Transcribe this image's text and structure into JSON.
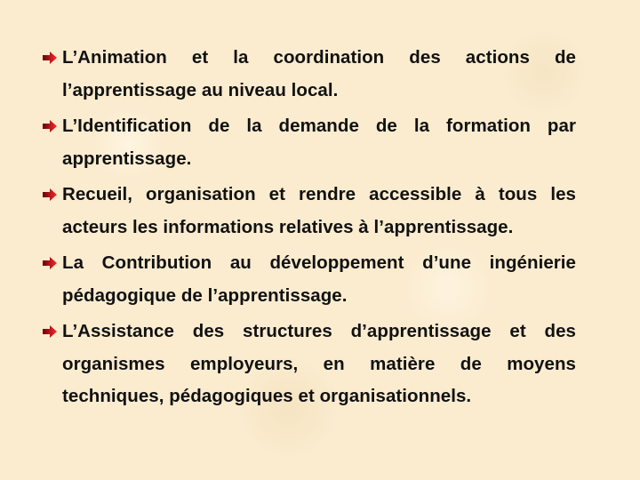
{
  "slide": {
    "bullet_icon": "red-arrow-right-icon",
    "bullet_color": "#d0101a",
    "items": [
      {
        "text": "L’Animation et la coordination des actions de l’apprentissage au niveau local."
      },
      {
        "text": "L’Identification de la demande de la formation par apprentissage."
      },
      {
        "text": "Recueil, organisation et rendre accessible à tous les acteurs les informations relatives à l’apprentissage."
      },
      {
        "text": "La Contribution au développement d’une ingénierie pédagogique de l’apprentissage."
      },
      {
        "text": "L’Assistance des structures d’apprentissage et des organismes employeurs, en matière de moyens techniques, pédagogiques et organisationnels."
      }
    ]
  }
}
